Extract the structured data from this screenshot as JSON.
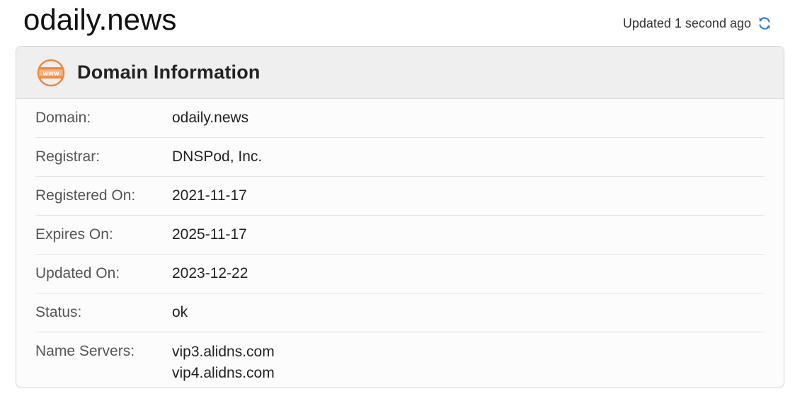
{
  "header": {
    "title": "odaily.news",
    "updated_text": "Updated 1 second ago",
    "refresh_icon": "refresh-icon"
  },
  "panel": {
    "title": "Domain Information",
    "icon": "www-globe-icon",
    "rows": [
      {
        "label": "Domain:",
        "value": "odaily.news"
      },
      {
        "label": "Registrar:",
        "value": "DNSPod, Inc."
      },
      {
        "label": "Registered On:",
        "value": "2021-11-17"
      },
      {
        "label": "Expires On:",
        "value": "2025-11-17"
      },
      {
        "label": "Updated On:",
        "value": "2023-12-22"
      },
      {
        "label": "Status:",
        "value": "ok"
      }
    ],
    "name_servers": {
      "label": "Name Servers:",
      "values": [
        "vip3.alidns.com",
        "vip4.alidns.com"
      ]
    }
  },
  "colors": {
    "accent_orange": "#f0883e",
    "refresh_blue": "#3b7dd8",
    "header_bg": "#efefef"
  }
}
